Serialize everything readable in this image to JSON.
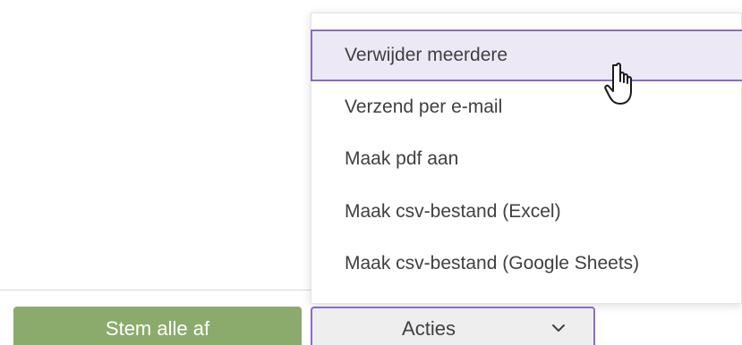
{
  "menu": {
    "items": [
      {
        "label": "Verwijder meerdere",
        "active": true
      },
      {
        "label": "Verzend per e-mail",
        "active": false
      },
      {
        "label": "Maak pdf aan",
        "active": false
      },
      {
        "label": "Maak csv-bestand (Excel)",
        "active": false
      },
      {
        "label": "Maak csv-bestand (Google Sheets)",
        "active": false
      }
    ]
  },
  "actions": {
    "approve_all_label": "Stem alle af",
    "dropdown_label": "Acties",
    "dropdown_icon": "chevron-down-icon"
  },
  "cursor": {
    "icon": "hand-pointer-icon"
  },
  "colors": {
    "accent": "#8a6cc4",
    "active_bg": "#ede8f6",
    "green": "#8bab6c"
  }
}
